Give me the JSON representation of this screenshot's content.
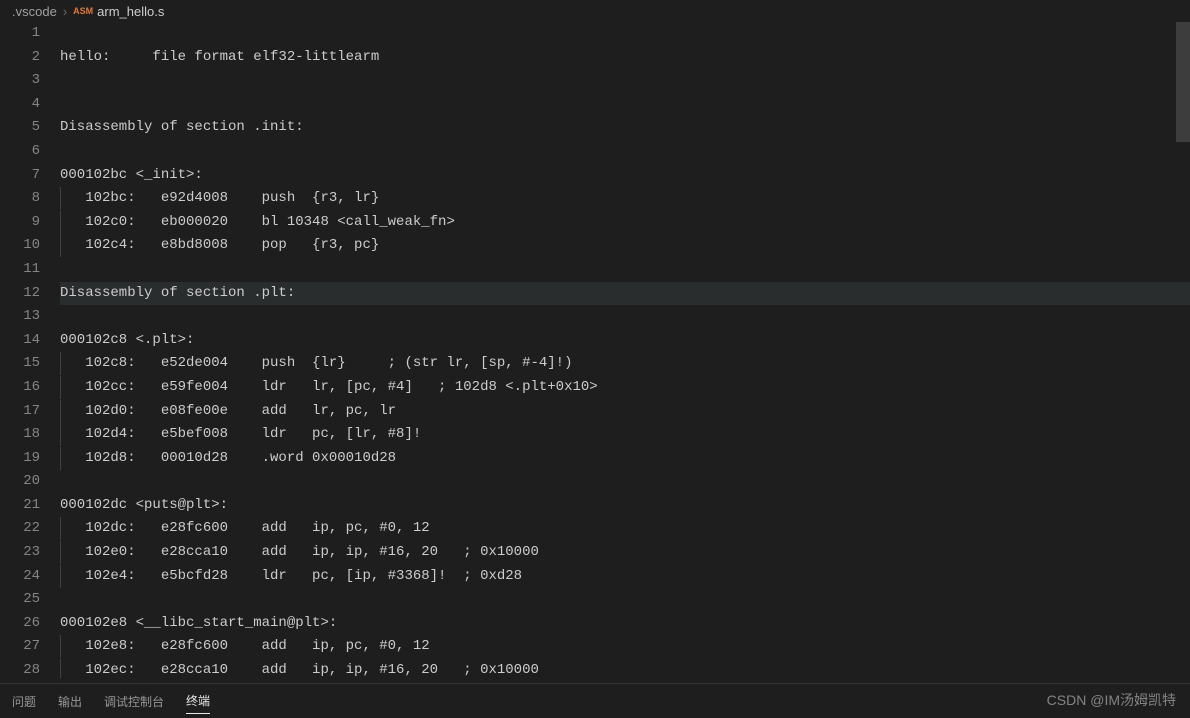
{
  "breadcrumb": {
    "folder": ".vscode",
    "badge": "ASM",
    "filename": "arm_hello.s"
  },
  "panel": {
    "tabs": [
      "问题",
      "输出",
      "调试控制台",
      "终端"
    ],
    "active_index": 3
  },
  "watermark": "CSDN @IM汤姆凯特",
  "current_line": 12,
  "lines": [
    {
      "num": 1,
      "text": ""
    },
    {
      "num": 2,
      "text": "hello:     file format elf32-littlearm"
    },
    {
      "num": 3,
      "text": ""
    },
    {
      "num": 4,
      "text": ""
    },
    {
      "num": 5,
      "text": "Disassembly of section .init:"
    },
    {
      "num": 6,
      "text": ""
    },
    {
      "num": 7,
      "text": "000102bc <_init>:"
    },
    {
      "num": 8,
      "text": "   102bc:   e92d4008    push  {r3, lr}",
      "indent": true
    },
    {
      "num": 9,
      "text": "   102c0:   eb000020    bl 10348 <call_weak_fn>",
      "indent": true
    },
    {
      "num": 10,
      "text": "   102c4:   e8bd8008    pop   {r3, pc}",
      "indent": true
    },
    {
      "num": 11,
      "text": ""
    },
    {
      "num": 12,
      "text": "Disassembly of section .plt:"
    },
    {
      "num": 13,
      "text": ""
    },
    {
      "num": 14,
      "text": "000102c8 <.plt>:"
    },
    {
      "num": 15,
      "text": "   102c8:   e52de004    push  {lr}     ; (str lr, [sp, #-4]!)",
      "indent": true
    },
    {
      "num": 16,
      "text": "   102cc:   e59fe004    ldr   lr, [pc, #4]   ; 102d8 <.plt+0x10>",
      "indent": true
    },
    {
      "num": 17,
      "text": "   102d0:   e08fe00e    add   lr, pc, lr",
      "indent": true
    },
    {
      "num": 18,
      "text": "   102d4:   e5bef008    ldr   pc, [lr, #8]!",
      "indent": true
    },
    {
      "num": 19,
      "text": "   102d8:   00010d28    .word 0x00010d28",
      "indent": true
    },
    {
      "num": 20,
      "text": ""
    },
    {
      "num": 21,
      "text": "000102dc <puts@plt>:"
    },
    {
      "num": 22,
      "text": "   102dc:   e28fc600    add   ip, pc, #0, 12",
      "indent": true
    },
    {
      "num": 23,
      "text": "   102e0:   e28cca10    add   ip, ip, #16, 20   ; 0x10000",
      "indent": true
    },
    {
      "num": 24,
      "text": "   102e4:   e5bcfd28    ldr   pc, [ip, #3368]!  ; 0xd28",
      "indent": true
    },
    {
      "num": 25,
      "text": ""
    },
    {
      "num": 26,
      "text": "000102e8 <__libc_start_main@plt>:"
    },
    {
      "num": 27,
      "text": "   102e8:   e28fc600    add   ip, pc, #0, 12",
      "indent": true
    },
    {
      "num": 28,
      "text": "   102ec:   e28cca10    add   ip, ip, #16, 20   ; 0x10000",
      "indent": true
    }
  ]
}
